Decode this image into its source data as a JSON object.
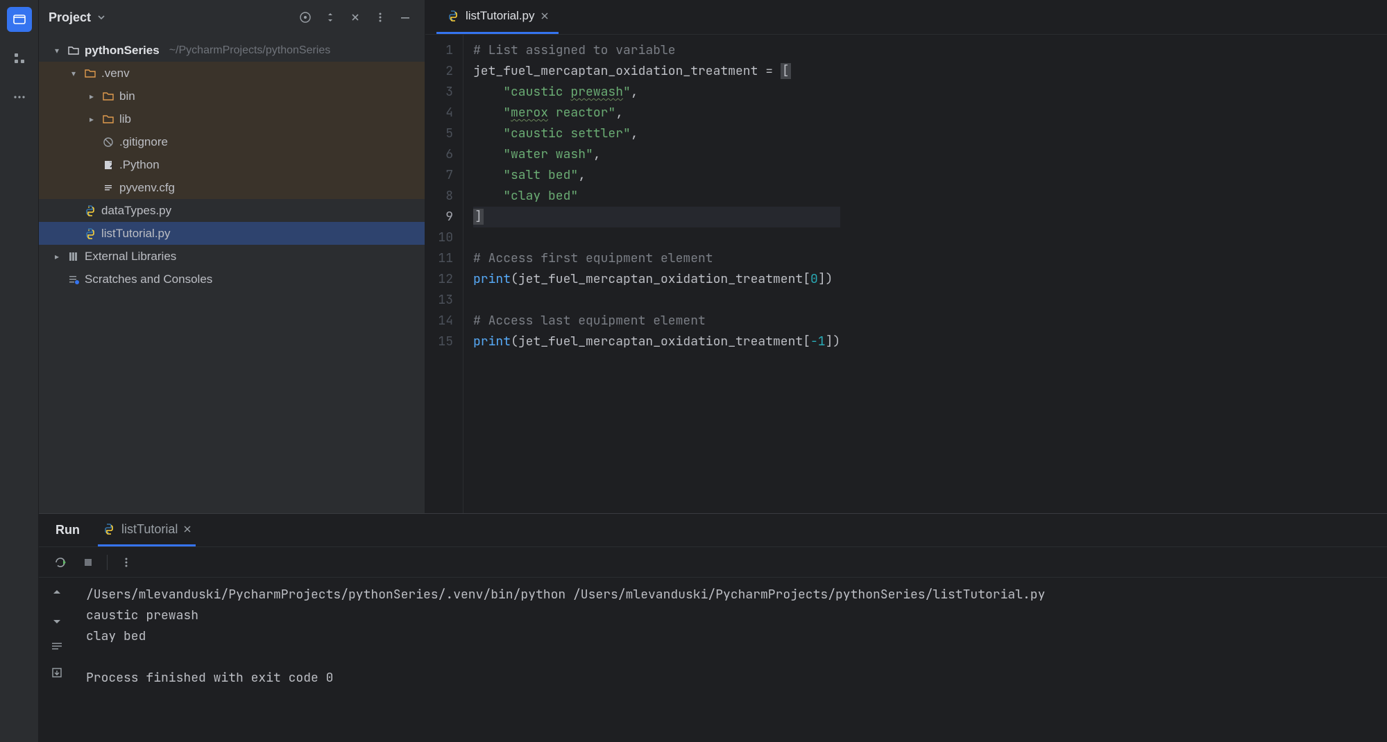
{
  "leftRail": {
    "project_tooltip": "Project",
    "structure_tooltip": "Structure",
    "more_tooltip": "More"
  },
  "projectPanel": {
    "title": "Project",
    "toolbar": {
      "select_opened_tooltip": "Select Opened File",
      "expand_tooltip": "Expand/Collapse",
      "hide_tooltip": "Hide",
      "options_tooltip": "Options",
      "minimize_tooltip": "Minimize"
    },
    "tree": {
      "root": {
        "name": "pythonSeries",
        "path": "~/PycharmProjects/pythonSeries"
      },
      "venv": {
        "name": ".venv"
      },
      "bin": {
        "name": "bin"
      },
      "lib": {
        "name": "lib"
      },
      "gitignore": {
        "name": ".gitignore"
      },
      "pythonlink": {
        "name": ".Python"
      },
      "pyvenvcfg": {
        "name": "pyvenv.cfg"
      },
      "dataTypes": {
        "name": "dataTypes.py"
      },
      "listTutorial": {
        "name": "listTutorial.py"
      },
      "extlib": {
        "name": "External Libraries"
      },
      "scratches": {
        "name": "Scratches and Consoles"
      }
    }
  },
  "editor": {
    "tab": {
      "label": "listTutorial.py"
    },
    "lines": [
      "# List assigned to variable",
      "jet_fuel_mercaptan_oxidation_treatment = [",
      "    \"caustic prewash\",",
      "    \"merox reactor\",",
      "    \"caustic settler\",",
      "    \"water wash\",",
      "    \"salt bed\",",
      "    \"clay bed\"",
      "]",
      "",
      "# Access first equipment element",
      "print(jet_fuel_mercaptan_oxidation_treatment[0])",
      "",
      "# Access last equipment element",
      "print(jet_fuel_mercaptan_oxidation_treatment[-1])"
    ],
    "lineNumbers": [
      "1",
      "2",
      "3",
      "4",
      "5",
      "6",
      "7",
      "8",
      "9",
      "10",
      "11",
      "12",
      "13",
      "14",
      "15"
    ]
  },
  "run": {
    "tab_run": "Run",
    "tab_file": "listTutorial",
    "output": [
      "/Users/mlevanduski/PycharmProjects/pythonSeries/.venv/bin/python /Users/mlevanduski/PycharmProjects/pythonSeries/listTutorial.py",
      "caustic prewash",
      "clay bed",
      "",
      "Process finished with exit code 0"
    ]
  }
}
